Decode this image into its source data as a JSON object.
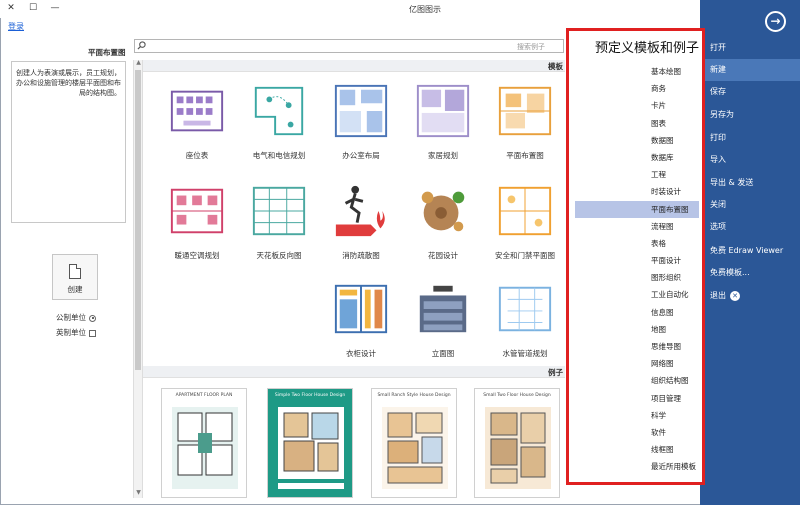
{
  "window": {
    "title": "亿图图示",
    "login_link": "登录",
    "controls": [
      "✕",
      "☐",
      "—"
    ]
  },
  "nav": {
    "items": [
      {
        "label": "打开",
        "active": false
      },
      {
        "label": "新建",
        "active": true
      },
      {
        "label": "保存",
        "active": false
      },
      {
        "label": "另存为",
        "active": false
      },
      {
        "label": "打印",
        "active": false
      },
      {
        "label": "导入",
        "active": false
      },
      {
        "label": "导出 & 发送",
        "active": false
      },
      {
        "label": "关闭",
        "active": false
      },
      {
        "label": "选项",
        "active": false
      },
      {
        "label": "免费 Edraw Viewer",
        "active": false
      },
      {
        "label": "免费模板...",
        "active": false
      },
      {
        "label": "退出",
        "active": false
      }
    ]
  },
  "categories": {
    "title": "预定义模板和例子",
    "items": [
      {
        "label": "基本绘图",
        "selected": false
      },
      {
        "label": "商务",
        "selected": false
      },
      {
        "label": "卡片",
        "selected": false
      },
      {
        "label": "图表",
        "selected": false
      },
      {
        "label": "数据图",
        "selected": false
      },
      {
        "label": "数据库",
        "selected": false
      },
      {
        "label": "工程",
        "selected": false
      },
      {
        "label": "时装设计",
        "selected": false
      },
      {
        "label": "平面布置图",
        "selected": true
      },
      {
        "label": "流程图",
        "selected": false
      },
      {
        "label": "表格",
        "selected": false
      },
      {
        "label": "平面设计",
        "selected": false
      },
      {
        "label": "图形组织",
        "selected": false
      },
      {
        "label": "工业自动化",
        "selected": false
      },
      {
        "label": "信息图",
        "selected": false
      },
      {
        "label": "地图",
        "selected": false
      },
      {
        "label": "思维导图",
        "selected": false
      },
      {
        "label": "网络图",
        "selected": false
      },
      {
        "label": "组织结构图",
        "selected": false
      },
      {
        "label": "项目管理",
        "selected": false
      },
      {
        "label": "科学",
        "selected": false
      },
      {
        "label": "软件",
        "selected": false
      },
      {
        "label": "线框图",
        "selected": false
      },
      {
        "label": "最近所用模板",
        "selected": false
      }
    ]
  },
  "search": {
    "placeholder": "搜索例子"
  },
  "templates": {
    "section_label": "模板",
    "items": [
      {
        "label": "平面布置图",
        "icon": "floorplan-icon"
      },
      {
        "label": "家居规划",
        "icon": "home-plan-icon"
      },
      {
        "label": "办公室布局",
        "icon": "office-layout-icon"
      },
      {
        "label": "电气和电信规划",
        "icon": "electrical-plan-icon"
      },
      {
        "label": "座位表",
        "icon": "seating-chart-icon"
      },
      {
        "label": "安全和门禁平面图",
        "icon": "security-plan-icon"
      },
      {
        "label": "花园设计",
        "icon": "garden-icon"
      },
      {
        "label": "消防疏散图",
        "icon": "fire-exit-icon"
      },
      {
        "label": "天花板反向图",
        "icon": "ceiling-plan-icon"
      },
      {
        "label": "暖通空调规划",
        "icon": "hvac-plan-icon"
      },
      {
        "label": "水管管道规划",
        "icon": "plumbing-icon"
      },
      {
        "label": "立面图",
        "icon": "elevation-icon"
      },
      {
        "label": "衣柜设计",
        "icon": "wardrobe-icon"
      }
    ]
  },
  "examples": {
    "section_label": "例子",
    "items": [
      {
        "title": "Small Two Floor House Design"
      },
      {
        "title": "Small Ranch Style House Design"
      },
      {
        "title": "Simple Two Floor House Design"
      },
      {
        "title": "APARTMENT FLOOR PLAN"
      }
    ]
  },
  "left_panel": {
    "title": "平面布置图",
    "description": "创建人为表演或展示，员工规划，办公和设施管理的楼层平面图和布局的结构图。",
    "create_label": "创建",
    "units": [
      {
        "label": "公制单位",
        "type": "radio",
        "checked": true
      },
      {
        "label": "英制单位",
        "type": "checkbox",
        "checked": false
      }
    ]
  },
  "colors": {
    "nav_bg": "#2b5797",
    "nav_active": "#4a78b8",
    "category_highlight": "#b7c4e6",
    "annotation_border": "#e02020"
  }
}
